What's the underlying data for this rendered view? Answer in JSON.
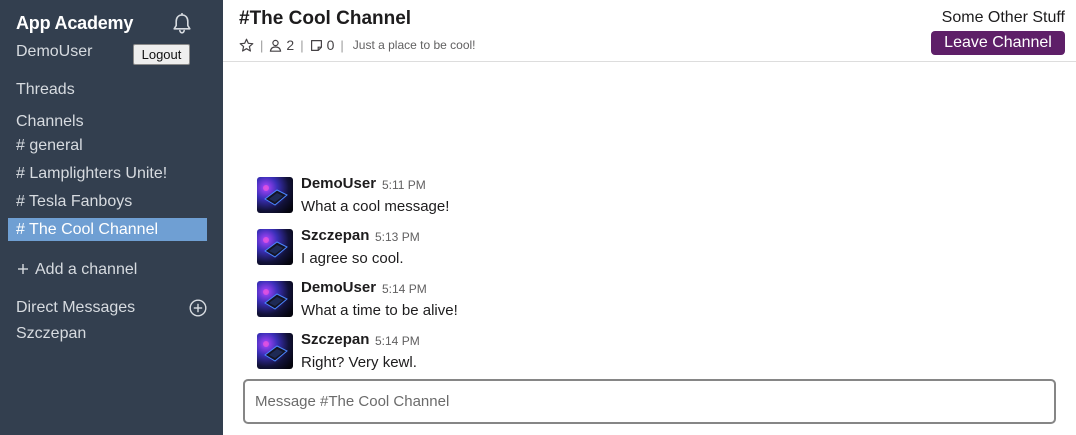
{
  "sidebar": {
    "workspace_name": "App Academy",
    "user_name": "DemoUser",
    "logout_label": "Logout",
    "threads_label": "Threads",
    "channels_heading": "Channels",
    "channels": [
      {
        "label": "# general",
        "active": false
      },
      {
        "label": "# Lamplighters Unite!",
        "active": false
      },
      {
        "label": "# Tesla Fanboys",
        "active": false
      },
      {
        "label": "# The Cool Channel",
        "active": true
      }
    ],
    "add_channel_label": "Add a channel",
    "dm_heading": "Direct Messages",
    "direct_messages": [
      "Szczepan"
    ]
  },
  "header": {
    "channel_title": "#The Cool Channel",
    "member_count": "2",
    "pinned_count": "0",
    "description": "Just a place to be cool!",
    "other_stuff": "Some Other Stuff",
    "leave_label": "Leave Channel"
  },
  "messages": [
    {
      "author": "DemoUser",
      "time": "5:11 PM",
      "text": "What a cool message!"
    },
    {
      "author": "Szczepan",
      "time": "5:13 PM",
      "text": "I agree so cool."
    },
    {
      "author": "DemoUser",
      "time": "5:14 PM",
      "text": "What a time to be alive!"
    },
    {
      "author": "Szczepan",
      "time": "5:14 PM",
      "text": "Right? Very kewl."
    }
  ],
  "composer": {
    "placeholder": "Message #The Cool Channel",
    "value": ""
  },
  "colors": {
    "sidebar_bg": "#333f4f",
    "active_channel_bg": "#6f9fd3",
    "leave_button_bg": "#5e1f68"
  },
  "icons": {
    "notifications": "bell-icon",
    "favorite": "star-icon",
    "members": "person-icon",
    "pins": "note-icon",
    "add_channel": "plus-icon",
    "add_dm": "circle-plus-icon",
    "avatar": "avatar-image"
  }
}
